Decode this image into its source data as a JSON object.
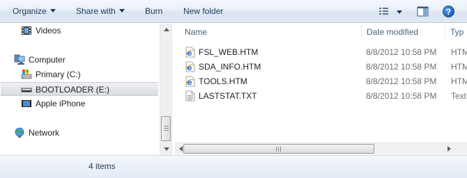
{
  "toolbar": {
    "organize_label": "Organize",
    "share_label": "Share with",
    "burn_label": "Burn",
    "new_folder_label": "New folder",
    "help_glyph": "?"
  },
  "nav": {
    "items": [
      {
        "label": "Videos",
        "icon": "video-folder-icon"
      },
      {
        "label": "Computer",
        "icon": "computer-icon"
      },
      {
        "label": "Primary (C:)",
        "icon": "drive-icon"
      },
      {
        "label": "BOOTLOADER (E:)",
        "icon": "removable-drive-icon",
        "selected": true
      },
      {
        "label": "Apple iPhone",
        "icon": "phone-icon"
      },
      {
        "label": "Network",
        "icon": "network-icon"
      }
    ]
  },
  "file_list": {
    "columns": [
      "Name",
      "Date modified",
      "Typ"
    ],
    "rows": [
      {
        "name": "FSL_WEB.HTM",
        "date": "8/8/2012 10:58 PM",
        "type": "HTM",
        "icon": "ie-document-icon"
      },
      {
        "name": "SDA_INFO.HTM",
        "date": "8/8/2012 10:58 PM",
        "type": "HTM",
        "icon": "ie-document-icon"
      },
      {
        "name": "TOOLS.HTM",
        "date": "8/8/2012 10:58 PM",
        "type": "HTM",
        "icon": "ie-document-icon"
      },
      {
        "name": "LASTSTAT.TXT",
        "date": "8/8/2012 10:58 PM",
        "type": "Text",
        "icon": "text-document-icon"
      }
    ]
  },
  "status": {
    "item_count": "4 items"
  },
  "colors": {
    "toolbar_text": "#1e395b",
    "header_text": "#4c607a",
    "secondary_text": "#6d6d6d",
    "ie_blue": "#1f6fd1",
    "ie_gold": "#e0a020"
  }
}
